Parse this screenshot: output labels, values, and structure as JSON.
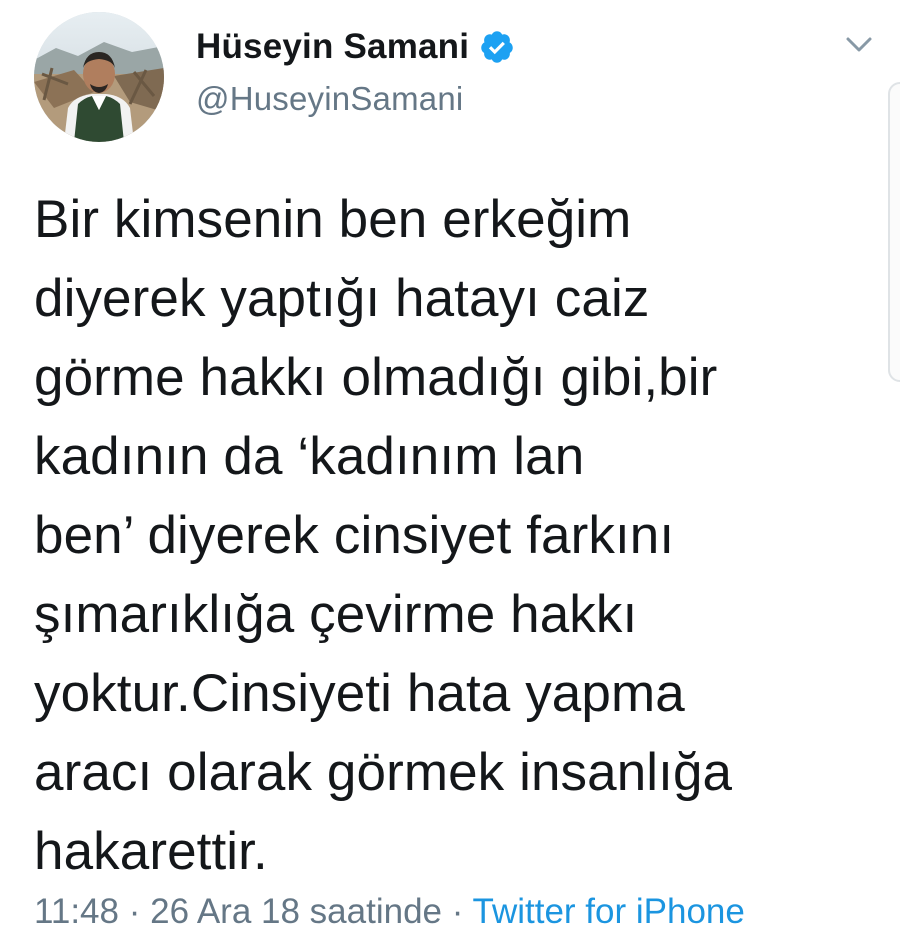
{
  "author": {
    "display_name": "Hüseyin Samani",
    "handle": "@HuseyinSamani",
    "verified": true
  },
  "icons": {
    "verified": "verified-badge-icon",
    "menu": "chevron-down-icon"
  },
  "tweet": {
    "text": "Bir kimsenin ben erkeğim\ndiyerek yaptığı hatayı caiz\ngörme hakkı olmadığı gibi,bir\nkadının da ‘kadınım lan\nben’ diyerek cinsiyet farkını\nşımarıklığa çevirme hakkı\nyoktur.Cinsiyeti hata yapma\naracı olarak görmek insanlığa\nhakarettir."
  },
  "meta": {
    "time": "11:48",
    "separator": " · ",
    "date": "26 Ara 18 saatinde",
    "source": "Twitter for iPhone"
  },
  "colors": {
    "text": "#14171a",
    "secondary": "#657786",
    "link": "#1b95e0",
    "verified": "#1da1f2"
  }
}
